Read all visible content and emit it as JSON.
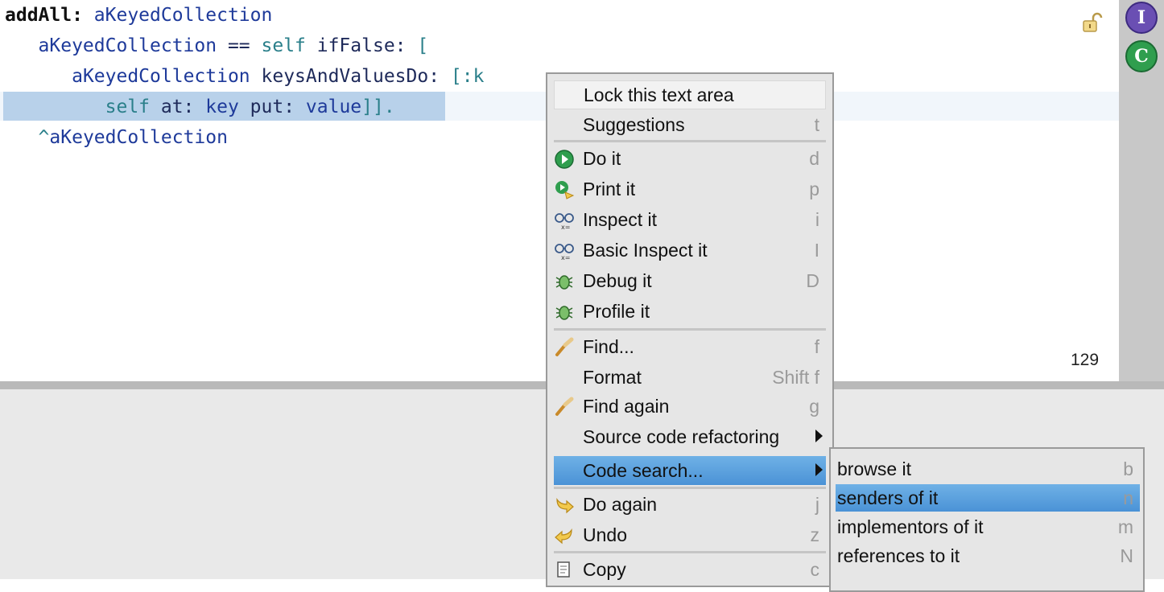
{
  "editor": {
    "lines": [
      {
        "parts": [
          "addAll:",
          " ",
          "aKeyedCollection"
        ]
      },
      {
        "parts": [
          "   ",
          "aKeyedCollection",
          " == ",
          "self",
          " ifFalse: ",
          "["
        ]
      },
      {
        "parts": [
          "      ",
          "aKeyedCollection",
          " keysAndValuesDo: ",
          "[:k"
        ]
      },
      {
        "parts": [
          "         ",
          "self",
          " at: ",
          "key",
          " put: ",
          "value",
          "]]."
        ]
      },
      {
        "parts": [
          "   ",
          "^",
          "aKeyedCollection"
        ]
      }
    ],
    "line_count": "129"
  },
  "gutter": {
    "inspect_label": "I",
    "class_label": "C",
    "lock_icon": "unlock-icon"
  },
  "menu": {
    "items": [
      {
        "label": "Lock this text area",
        "shortcut": ""
      },
      {
        "label": "Suggestions",
        "shortcut": "t"
      },
      {
        "label": "Do it",
        "shortcut": "d",
        "icon": "do-it-icon"
      },
      {
        "label": "Print it",
        "shortcut": "p",
        "icon": "print-it-icon"
      },
      {
        "label": "Inspect it",
        "shortcut": "i",
        "icon": "inspect-icon"
      },
      {
        "label": "Basic Inspect it",
        "shortcut": "I",
        "icon": "inspect-icon"
      },
      {
        "label": "Debug it",
        "shortcut": "D",
        "icon": "bug-icon"
      },
      {
        "label": "Profile it",
        "shortcut": "",
        "icon": "bug-icon"
      },
      {
        "label": "Find...",
        "shortcut": "f",
        "icon": "find-icon"
      },
      {
        "label": "Format",
        "shortcut": "Shift f"
      },
      {
        "label": "Find again",
        "shortcut": "g",
        "icon": "find-icon"
      },
      {
        "label": "Source code refactoring",
        "shortcut": ""
      },
      {
        "label": "Code search...",
        "shortcut": ""
      },
      {
        "label": "Do again",
        "shortcut": "j",
        "icon": "redo-icon"
      },
      {
        "label": "Undo",
        "shortcut": "z",
        "icon": "undo-icon"
      },
      {
        "label": "Copy",
        "shortcut": "c",
        "icon": "copy-icon"
      }
    ]
  },
  "submenu": {
    "items": [
      {
        "label": "browse it",
        "shortcut": "b"
      },
      {
        "label": "senders of it",
        "shortcut": "n"
      },
      {
        "label": "implementors of it",
        "shortcut": "m"
      },
      {
        "label": "references to it",
        "shortcut": "N"
      }
    ]
  },
  "colors": {
    "selection": "#b8d1ea",
    "menu_highlight": "#4a92d6",
    "variable": "#1e3a9a",
    "self_keyword": "#2a7f8a"
  }
}
